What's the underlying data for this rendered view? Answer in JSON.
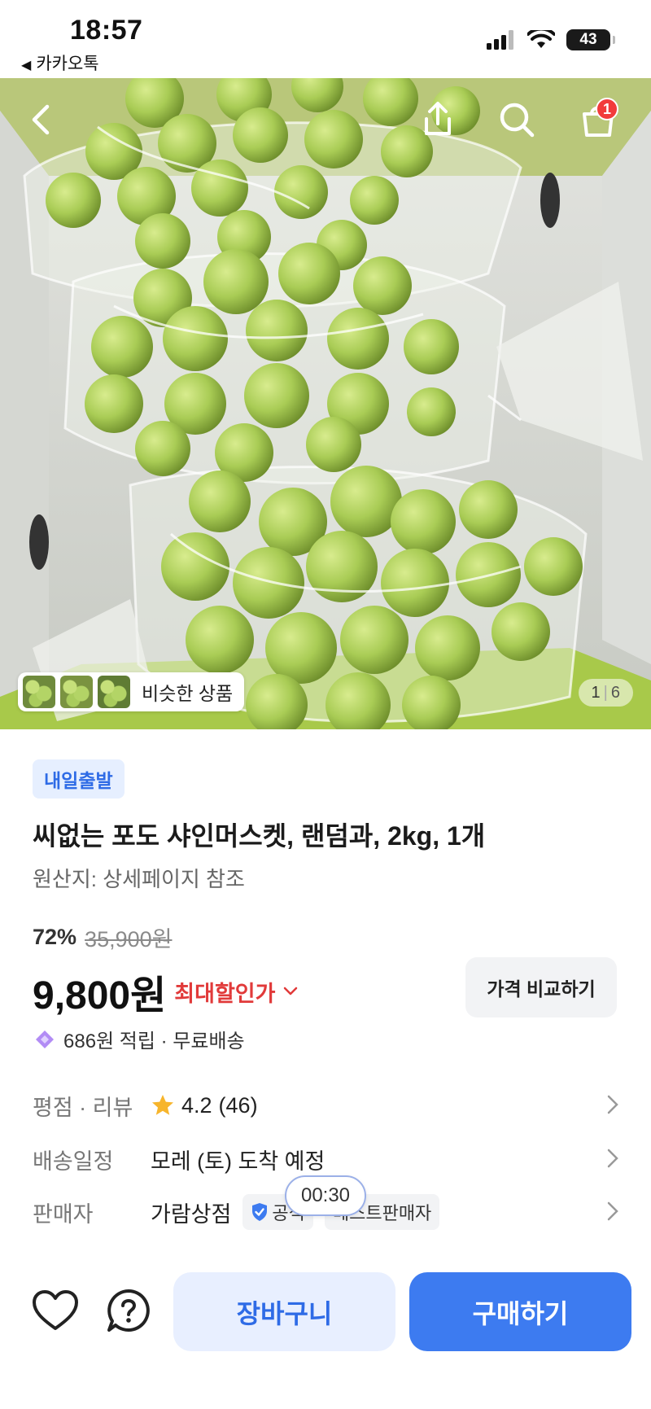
{
  "status_bar": {
    "time": "18:57",
    "back_app_label": "카카오톡",
    "battery": "43",
    "icons": [
      "signal-icon",
      "wifi-icon",
      "battery-icon"
    ]
  },
  "hero": {
    "icons": [
      "back-arrow-icon",
      "share-icon",
      "search-icon",
      "shopping-bag-icon"
    ],
    "cart_badge": "1",
    "similar_label": "비슷한 상품",
    "page_current": "1",
    "page_total": "6"
  },
  "product": {
    "tag": "내일출발",
    "title": "씨없는 포도 샤인머스켓, 랜덤과, 2kg, 1개",
    "origin": "원산지: 상세페이지 참조",
    "discount_rate": "72%",
    "original_price": "35,900원",
    "price": "9,800원",
    "max_discount_label": "최대할인가",
    "compare_label": "가격 비교하기",
    "points": "686원 적립 · 무료배송"
  },
  "info": {
    "rating_key": "평점 · 리뷰",
    "rating_value": "4.2",
    "rating_count": "(46)",
    "delivery_key": "배송일정",
    "delivery_value": "모레 (토) 도착 예정",
    "seller_key": "판매자",
    "seller_value": "가람상점",
    "chip_official": "공식",
    "chip_best": "베스트판매자",
    "timer": "00:30"
  },
  "bottom_bar": {
    "cart_label": "장바구니",
    "buy_label": "구매하기",
    "icons": [
      "heart-icon",
      "question-icon"
    ]
  },
  "colors": {
    "accent": "#3d7bf0",
    "sale_red": "#e13a3a",
    "tag_bg": "#e6efff",
    "badge_red": "#f23b3b"
  }
}
